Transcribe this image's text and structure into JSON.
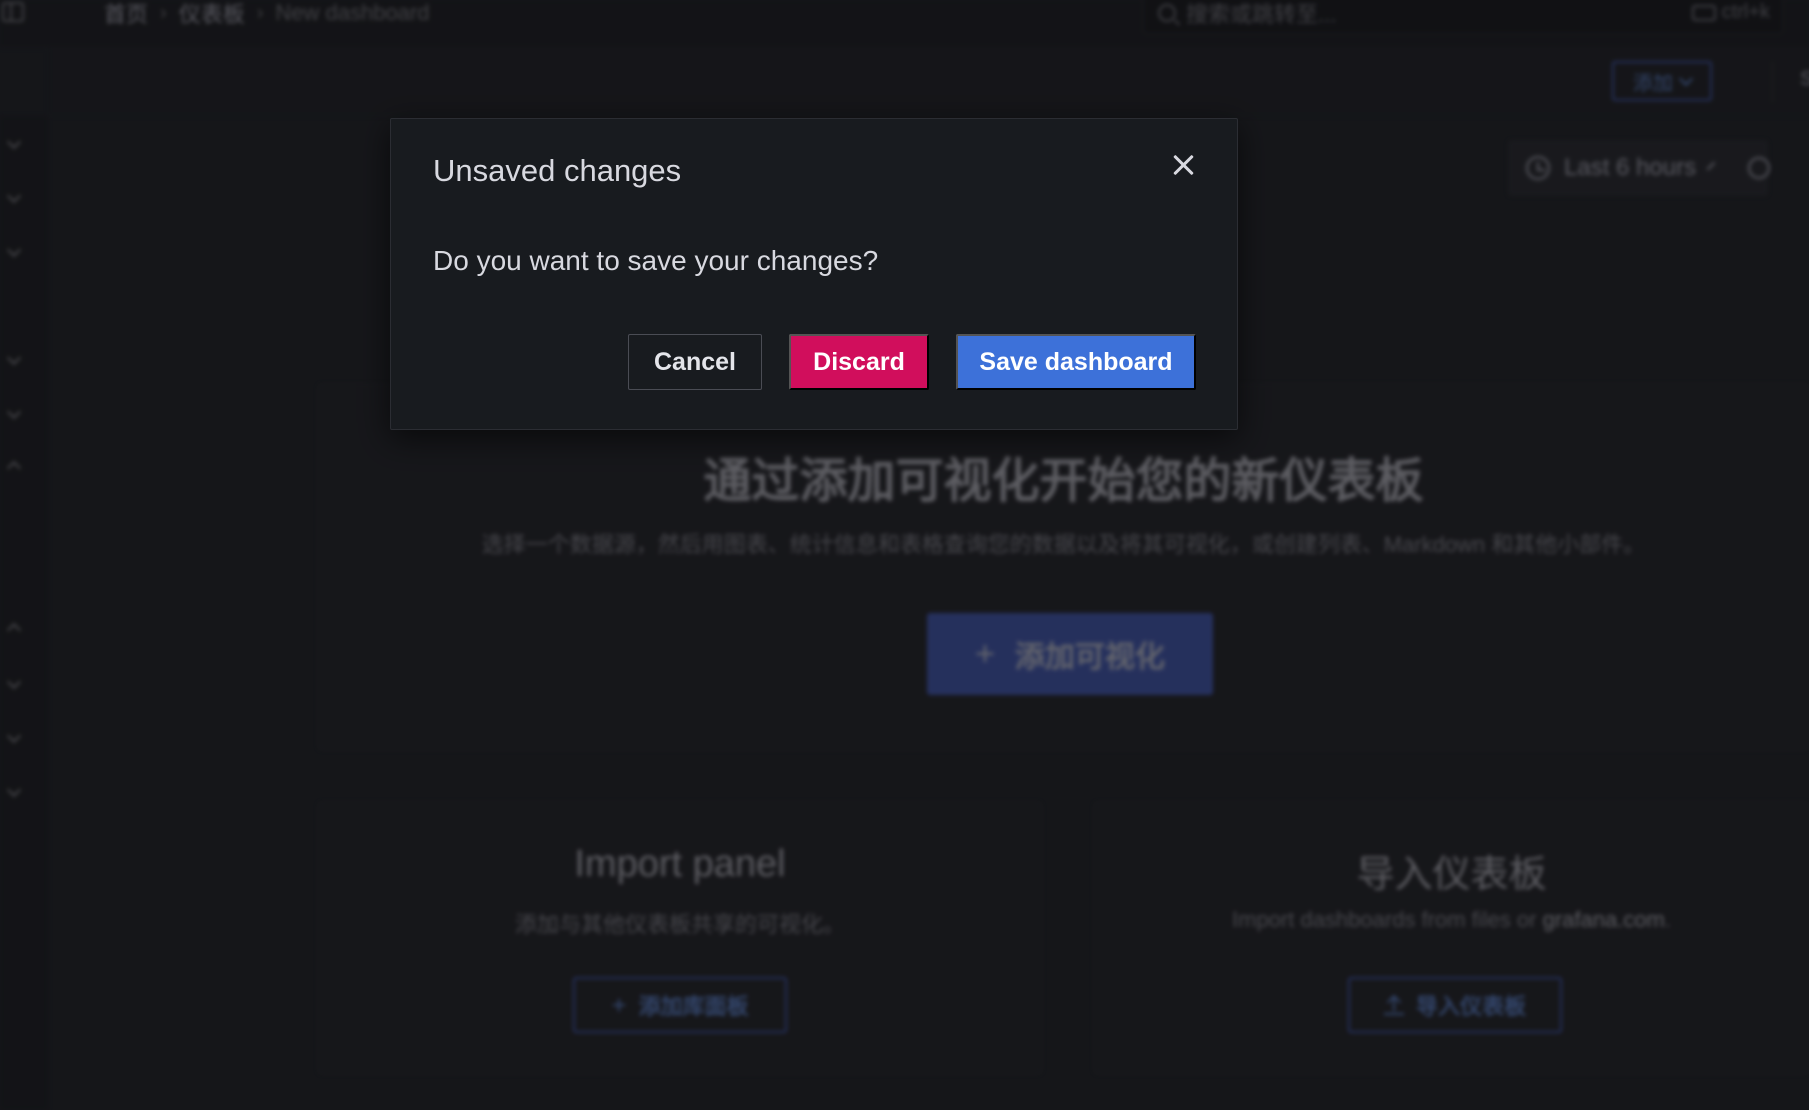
{
  "header": {
    "breadcrumb": [
      "首页",
      "仪表板",
      "New dashboard"
    ],
    "breadcrumb_separator": "›",
    "search_placeholder": "搜索或跳转至...",
    "search_shortcut": "ctrl+k"
  },
  "toolbar": {
    "add_label": "添加",
    "settings_label": "Settin"
  },
  "time_picker": {
    "label": "Last 6 hours"
  },
  "empty_state": {
    "title": "通过添加可视化开始您的新仪表板",
    "description": "选择一个数据源，然后用图表、统计信息和表格查询您的数据以及将其可视化，或创建列表、Markdown 和其他小部件。",
    "add_viz_label": "添加可视化",
    "plus_glyph": "+"
  },
  "import_panel": {
    "title": "Import panel",
    "description": "添加与其他仪表板共享的可视化。",
    "button_label": "添加库面板"
  },
  "import_dashboard": {
    "title": "导入仪表板",
    "description_prefix": "Import dashboards from files or ",
    "description_link": "grafana.com",
    "description_suffix": ".",
    "button_label": "导入仪表板"
  },
  "modal": {
    "title": "Unsaved changes",
    "body": "Do you want to save your changes?",
    "cancel_label": "Cancel",
    "discard_label": "Discard",
    "save_label": "Save dashboard"
  },
  "colors": {
    "discard": "#d10e5c",
    "save": "#3d71d9",
    "primary_blue": "#4a66d6"
  }
}
